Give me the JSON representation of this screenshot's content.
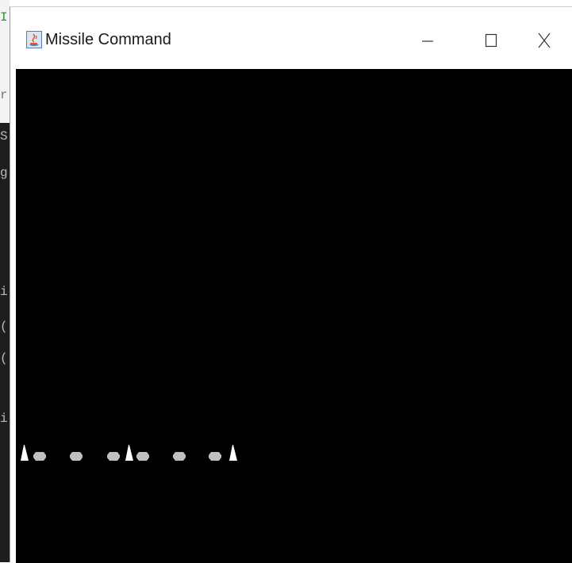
{
  "window": {
    "title": "Missile Command",
    "icon": "java-coffee-cup-icon",
    "controls": [
      "minimize-icon",
      "maximize-icon",
      "close-icon"
    ]
  },
  "background_editor": {
    "fragments": [
      "I",
      "r",
      "S",
      "g",
      "i",
      "(",
      "(",
      "i"
    ]
  },
  "game": {
    "background_color": "#000000",
    "bases": [
      {
        "name": "left-missile-base",
        "color": "#ffffff"
      },
      {
        "name": "center-missile-base",
        "color": "#ffffff"
      },
      {
        "name": "right-missile-base",
        "color": "#ffffff"
      }
    ],
    "cities": [
      {
        "name": "city-1",
        "color": "#c0c0c0"
      },
      {
        "name": "city-2",
        "color": "#c0c0c0"
      },
      {
        "name": "city-3",
        "color": "#c0c0c0"
      },
      {
        "name": "city-4",
        "color": "#c0c0c0"
      },
      {
        "name": "city-5",
        "color": "#c0c0c0"
      },
      {
        "name": "city-6",
        "color": "#c0c0c0"
      }
    ]
  }
}
